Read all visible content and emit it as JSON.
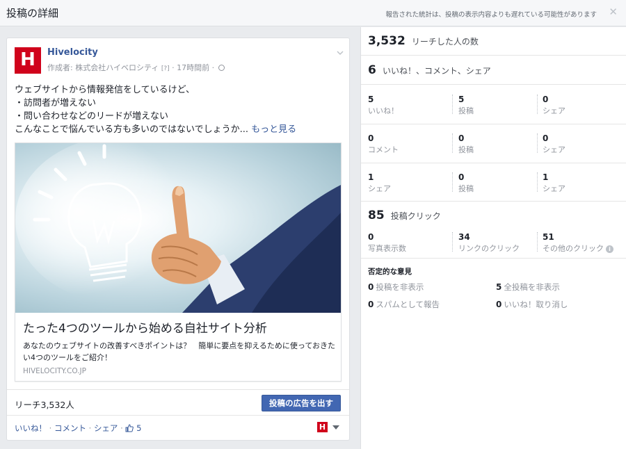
{
  "header": {
    "title": "投稿の詳細",
    "note": "報告された統計は、投稿の表示内容よりも遅れている可能性があります",
    "close_symbol": "✕"
  },
  "post": {
    "page_name": "Hivelocity",
    "avatar_letter": "H",
    "byline_author": "作成者: 株式会社ハイベロシティ",
    "byline_marker": "[?]",
    "byline_time": "· 17時間前 ·",
    "brand_color": "#d0021b",
    "text_lines": [
      "ウェブサイトから情報発信をしているけど、",
      "・訪問者が増えない",
      "・問い合わせなどのリードが増えない"
    ],
    "text_last": "こんなことで悩んでいる方も多いのではないでしょうか...",
    "see_more": "もっと見る",
    "link": {
      "title": "たった4つのツールから始める自社サイト分析",
      "description": "あなたのウェブサイトの改善すべきポイントは？　簡単に要点を抑えるために使っておきたい4つのツールをご紹介！",
      "domain": "HIVELOCITY.CO.JP"
    },
    "reach": "リーチ3,532人",
    "boost_button": "投稿の広告を出す",
    "actions": {
      "like": "いいね！",
      "comment": "コメント",
      "share": "シェア",
      "like_count": "5"
    }
  },
  "stats": {
    "reach": {
      "value": "3,532",
      "label": "リーチした人の数"
    },
    "engagement": {
      "value": "6",
      "label": "いいね！、コメント、シェア"
    },
    "rows": [
      [
        {
          "value": "5",
          "label": "いいね！"
        },
        {
          "value": "5",
          "label": "投稿"
        },
        {
          "value": "0",
          "label": "シェア"
        }
      ],
      [
        {
          "value": "0",
          "label": "コメント"
        },
        {
          "value": "0",
          "label": "投稿"
        },
        {
          "value": "0",
          "label": "シェア"
        }
      ],
      [
        {
          "value": "1",
          "label": "シェア"
        },
        {
          "value": "0",
          "label": "投稿"
        },
        {
          "value": "1",
          "label": "シェア"
        }
      ]
    ],
    "clicks": {
      "value": "85",
      "label": "投稿クリック",
      "items": [
        {
          "value": "0",
          "label": "写真表示数"
        },
        {
          "value": "34",
          "label": "リンクのクリック"
        },
        {
          "value": "51",
          "label": "その他のクリック"
        }
      ]
    },
    "negative": {
      "title": "否定的な意見",
      "items": [
        {
          "value": "0",
          "label": "投稿を非表示"
        },
        {
          "value": "5",
          "label": "全投稿を非表示"
        },
        {
          "value": "0",
          "label": "スパムとして報告"
        },
        {
          "value": "0",
          "label": "いいね！取り消し"
        }
      ]
    }
  }
}
